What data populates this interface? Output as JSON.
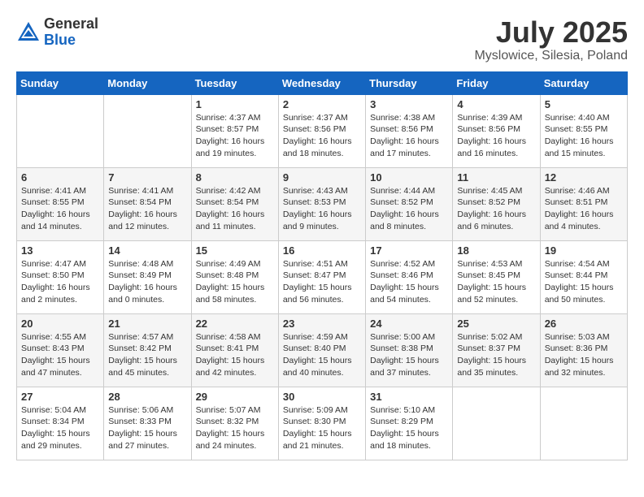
{
  "header": {
    "logo_general": "General",
    "logo_blue": "Blue",
    "month_year": "July 2025",
    "location": "Myslowice, Silesia, Poland"
  },
  "weekdays": [
    "Sunday",
    "Monday",
    "Tuesday",
    "Wednesday",
    "Thursday",
    "Friday",
    "Saturday"
  ],
  "weeks": [
    [
      {
        "day": "",
        "info": ""
      },
      {
        "day": "",
        "info": ""
      },
      {
        "day": "1",
        "info": "Sunrise: 4:37 AM\nSunset: 8:57 PM\nDaylight: 16 hours\nand 19 minutes."
      },
      {
        "day": "2",
        "info": "Sunrise: 4:37 AM\nSunset: 8:56 PM\nDaylight: 16 hours\nand 18 minutes."
      },
      {
        "day": "3",
        "info": "Sunrise: 4:38 AM\nSunset: 8:56 PM\nDaylight: 16 hours\nand 17 minutes."
      },
      {
        "day": "4",
        "info": "Sunrise: 4:39 AM\nSunset: 8:56 PM\nDaylight: 16 hours\nand 16 minutes."
      },
      {
        "day": "5",
        "info": "Sunrise: 4:40 AM\nSunset: 8:55 PM\nDaylight: 16 hours\nand 15 minutes."
      }
    ],
    [
      {
        "day": "6",
        "info": "Sunrise: 4:41 AM\nSunset: 8:55 PM\nDaylight: 16 hours\nand 14 minutes."
      },
      {
        "day": "7",
        "info": "Sunrise: 4:41 AM\nSunset: 8:54 PM\nDaylight: 16 hours\nand 12 minutes."
      },
      {
        "day": "8",
        "info": "Sunrise: 4:42 AM\nSunset: 8:54 PM\nDaylight: 16 hours\nand 11 minutes."
      },
      {
        "day": "9",
        "info": "Sunrise: 4:43 AM\nSunset: 8:53 PM\nDaylight: 16 hours\nand 9 minutes."
      },
      {
        "day": "10",
        "info": "Sunrise: 4:44 AM\nSunset: 8:52 PM\nDaylight: 16 hours\nand 8 minutes."
      },
      {
        "day": "11",
        "info": "Sunrise: 4:45 AM\nSunset: 8:52 PM\nDaylight: 16 hours\nand 6 minutes."
      },
      {
        "day": "12",
        "info": "Sunrise: 4:46 AM\nSunset: 8:51 PM\nDaylight: 16 hours\nand 4 minutes."
      }
    ],
    [
      {
        "day": "13",
        "info": "Sunrise: 4:47 AM\nSunset: 8:50 PM\nDaylight: 16 hours\nand 2 minutes."
      },
      {
        "day": "14",
        "info": "Sunrise: 4:48 AM\nSunset: 8:49 PM\nDaylight: 16 hours\nand 0 minutes."
      },
      {
        "day": "15",
        "info": "Sunrise: 4:49 AM\nSunset: 8:48 PM\nDaylight: 15 hours\nand 58 minutes."
      },
      {
        "day": "16",
        "info": "Sunrise: 4:51 AM\nSunset: 8:47 PM\nDaylight: 15 hours\nand 56 minutes."
      },
      {
        "day": "17",
        "info": "Sunrise: 4:52 AM\nSunset: 8:46 PM\nDaylight: 15 hours\nand 54 minutes."
      },
      {
        "day": "18",
        "info": "Sunrise: 4:53 AM\nSunset: 8:45 PM\nDaylight: 15 hours\nand 52 minutes."
      },
      {
        "day": "19",
        "info": "Sunrise: 4:54 AM\nSunset: 8:44 PM\nDaylight: 15 hours\nand 50 minutes."
      }
    ],
    [
      {
        "day": "20",
        "info": "Sunrise: 4:55 AM\nSunset: 8:43 PM\nDaylight: 15 hours\nand 47 minutes."
      },
      {
        "day": "21",
        "info": "Sunrise: 4:57 AM\nSunset: 8:42 PM\nDaylight: 15 hours\nand 45 minutes."
      },
      {
        "day": "22",
        "info": "Sunrise: 4:58 AM\nSunset: 8:41 PM\nDaylight: 15 hours\nand 42 minutes."
      },
      {
        "day": "23",
        "info": "Sunrise: 4:59 AM\nSunset: 8:40 PM\nDaylight: 15 hours\nand 40 minutes."
      },
      {
        "day": "24",
        "info": "Sunrise: 5:00 AM\nSunset: 8:38 PM\nDaylight: 15 hours\nand 37 minutes."
      },
      {
        "day": "25",
        "info": "Sunrise: 5:02 AM\nSunset: 8:37 PM\nDaylight: 15 hours\nand 35 minutes."
      },
      {
        "day": "26",
        "info": "Sunrise: 5:03 AM\nSunset: 8:36 PM\nDaylight: 15 hours\nand 32 minutes."
      }
    ],
    [
      {
        "day": "27",
        "info": "Sunrise: 5:04 AM\nSunset: 8:34 PM\nDaylight: 15 hours\nand 29 minutes."
      },
      {
        "day": "28",
        "info": "Sunrise: 5:06 AM\nSunset: 8:33 PM\nDaylight: 15 hours\nand 27 minutes."
      },
      {
        "day": "29",
        "info": "Sunrise: 5:07 AM\nSunset: 8:32 PM\nDaylight: 15 hours\nand 24 minutes."
      },
      {
        "day": "30",
        "info": "Sunrise: 5:09 AM\nSunset: 8:30 PM\nDaylight: 15 hours\nand 21 minutes."
      },
      {
        "day": "31",
        "info": "Sunrise: 5:10 AM\nSunset: 8:29 PM\nDaylight: 15 hours\nand 18 minutes."
      },
      {
        "day": "",
        "info": ""
      },
      {
        "day": "",
        "info": ""
      }
    ]
  ]
}
